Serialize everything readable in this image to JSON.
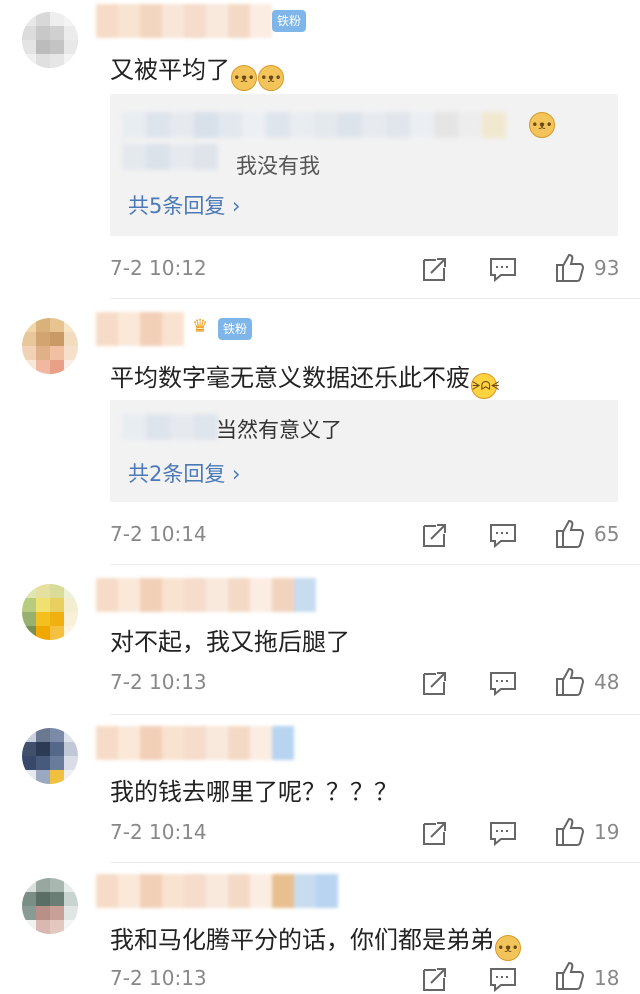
{
  "badge_label": "铁粉",
  "comments": [
    {
      "text": "又被平均了",
      "emoji_count": 2,
      "reply_text": "我没有我",
      "reply_suffix": "是",
      "reply_more": "共5条回复 ›",
      "time": "7-2 10:12",
      "likes": "93"
    },
    {
      "text": "平均数字毫无意义数据还乐此不疲",
      "reply_text": "当然有意义了",
      "reply_more": "共2条回复 ›",
      "time": "7-2 10:14",
      "likes": "65"
    },
    {
      "text": "对不起，我又拖后腿了",
      "time": "7-2 10:13",
      "likes": "48"
    },
    {
      "text": "我的钱去哪里了呢？？？？",
      "time": "7-2 10:14",
      "likes": "19"
    },
    {
      "text": "我和马化腾平分的话，你们都是弟弟",
      "time": "7-2 10:13",
      "likes": "18"
    }
  ],
  "icons": {
    "share": "share-icon",
    "comment": "comment-icon",
    "like": "like-icon"
  }
}
